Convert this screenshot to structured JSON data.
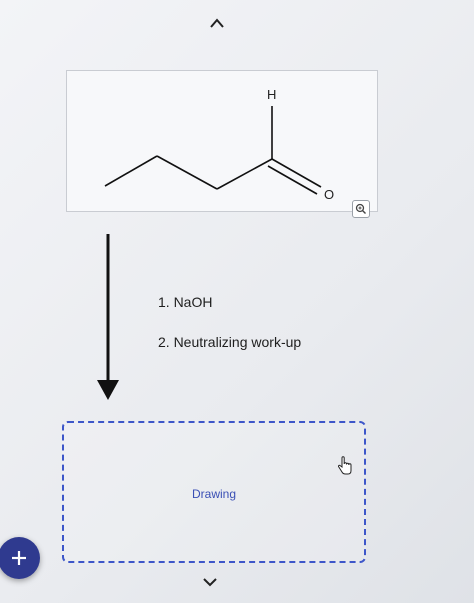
{
  "structure": {
    "atoms": {
      "hydrogen": "H",
      "oxygen": "O"
    },
    "zoom_icon": "magnifier-icon"
  },
  "reaction": {
    "conditions": [
      "1. NaOH",
      "2. Neutralizing work-up"
    ]
  },
  "drawing": {
    "label": "Drawing"
  },
  "controls": {
    "add_icon": "plus-icon",
    "nav_up_icon": "chevron-up-icon",
    "nav_down_icon": "chevron-down-icon"
  },
  "colors": {
    "accent": "#2f3a8f",
    "dashed_border": "#3d56c9"
  }
}
